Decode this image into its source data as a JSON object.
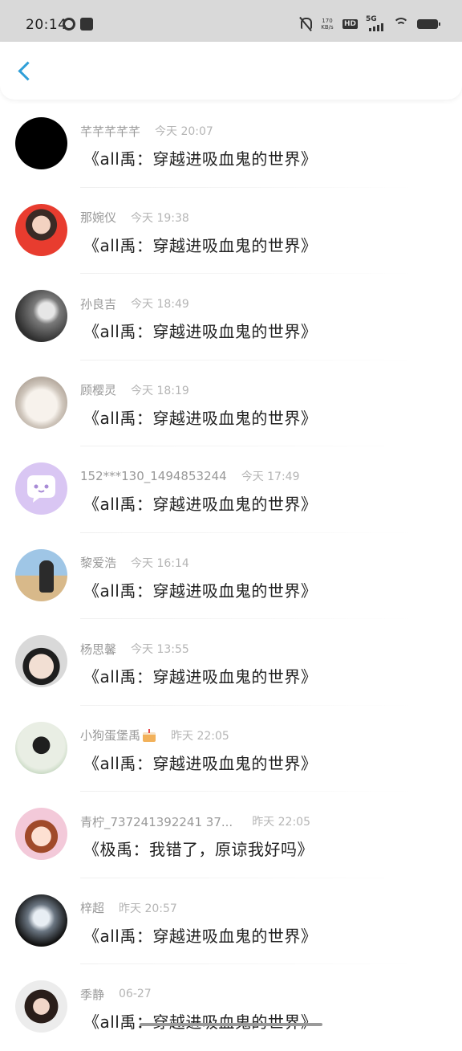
{
  "status_bar": {
    "time": "20:14",
    "speed_value": "170",
    "speed_unit": "KB/s",
    "hd_label": "HD",
    "network_label": "5G"
  },
  "items": [
    {
      "name": "芊芊芊芊芊",
      "time": "今天 20:07",
      "title": "《all禹：穿越进吸血鬼的世界》",
      "avatar_icon": "avatar-black"
    },
    {
      "name": "那婉仪",
      "time": "今天 19:38",
      "title": "《all禹：穿越进吸血鬼的世界》",
      "avatar_icon": "avatar-girl-red"
    },
    {
      "name": "孙良吉",
      "time": "今天 18:49",
      "title": "《all禹：穿越进吸血鬼的世界》",
      "avatar_icon": "avatar-gray"
    },
    {
      "name": "顾樱灵",
      "time": "今天 18:19",
      "title": "《all禹：穿越进吸血鬼的世界》",
      "avatar_icon": "avatar-dog"
    },
    {
      "name": "152***130_1494853244",
      "time": "今天 17:49",
      "title": "《all禹：穿越进吸血鬼的世界》",
      "avatar_icon": "avatar-default-purple"
    },
    {
      "name": "黎爱浩",
      "time": "今天 16:14",
      "title": "《all禹：穿越进吸血鬼的世界》",
      "avatar_icon": "avatar-beach"
    },
    {
      "name": "杨思馨",
      "time": "今天 13:55",
      "title": "《all禹：穿越进吸血鬼的世界》",
      "avatar_icon": "avatar-boy"
    },
    {
      "name": "小狗蛋堡禹",
      "time": "昨天 22:05",
      "title": "《all禹：穿越进吸血鬼的世界》",
      "avatar_icon": "avatar-mask",
      "has_cake": true
    },
    {
      "name": "青柠_737241392241 37...",
      "time": "昨天 22:05",
      "title": "《极禹：我错了，原谅我好吗》",
      "avatar_icon": "avatar-cartoon"
    },
    {
      "name": "梓超",
      "time": "昨天 20:57",
      "title": "《all禹：穿越进吸血鬼的世界》",
      "avatar_icon": "avatar-dark"
    },
    {
      "name": "季静",
      "time": "06-27",
      "title": "《all禹：穿越进吸血鬼的世界》",
      "avatar_icon": "avatar-woman"
    }
  ]
}
